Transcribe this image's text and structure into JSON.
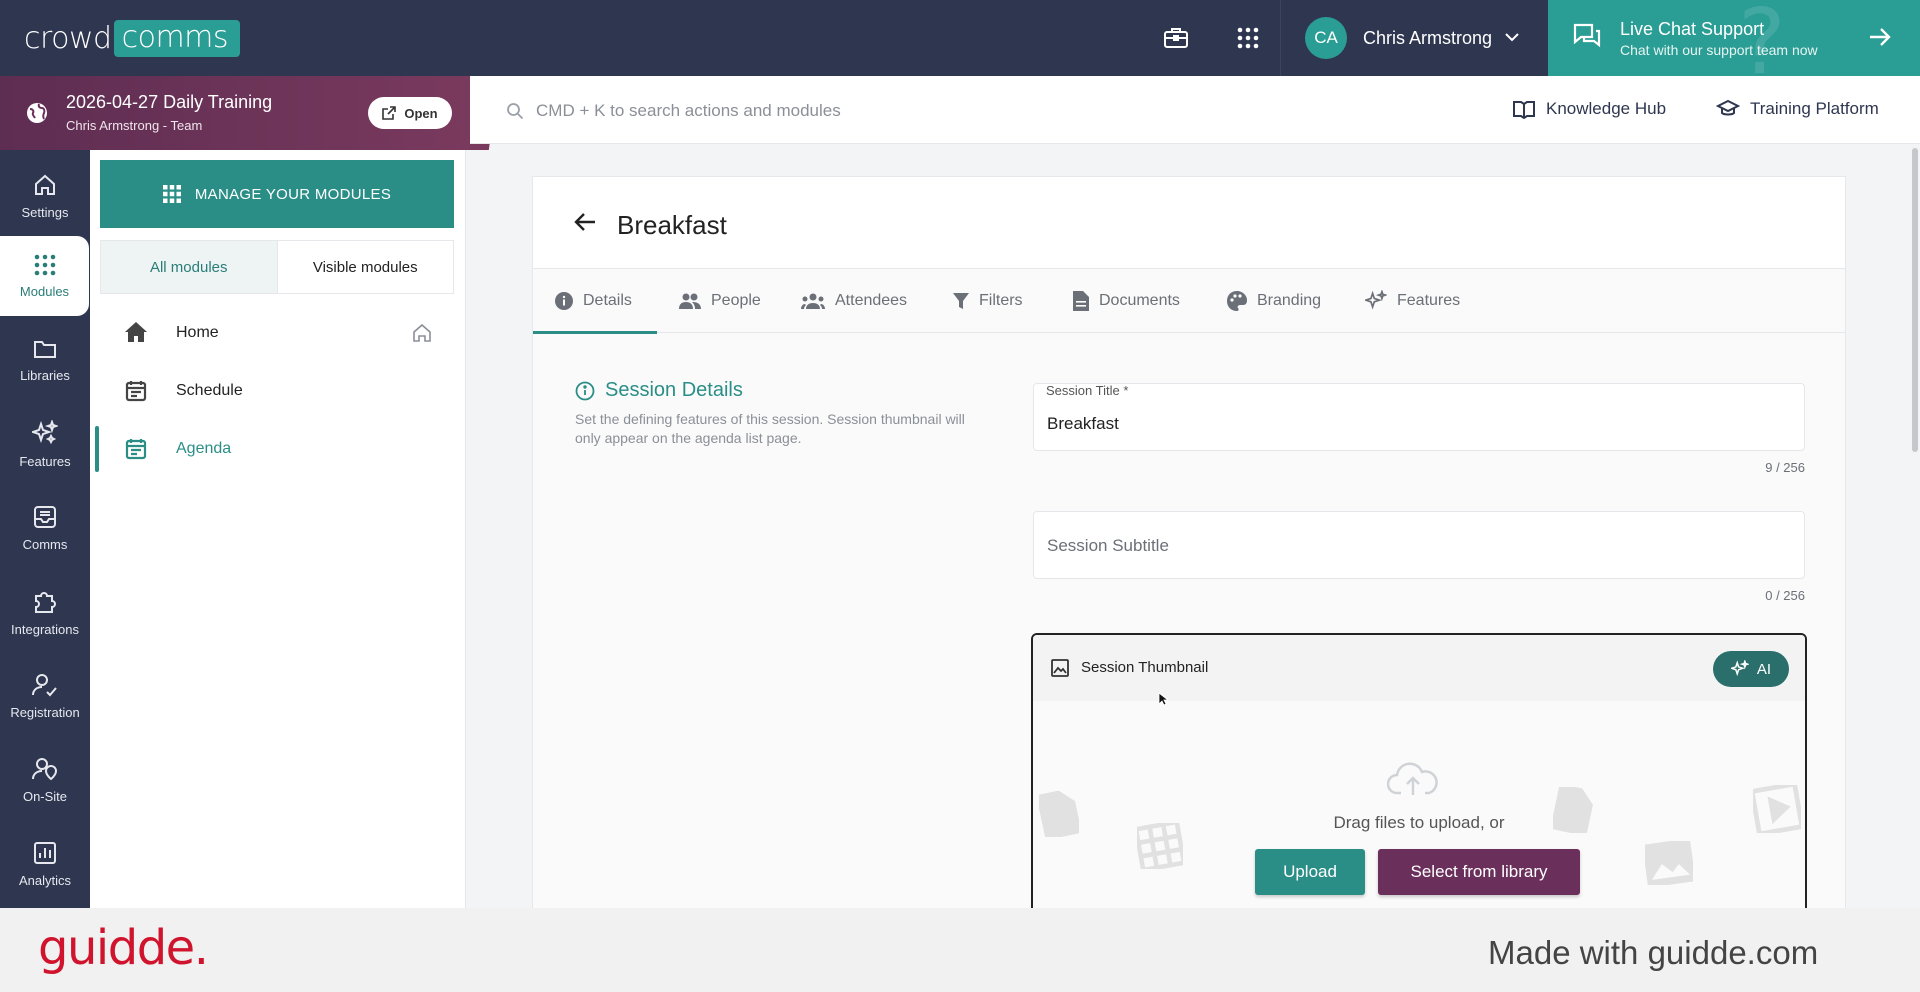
{
  "topbar": {
    "logo_left": "crowd",
    "logo_right": "comms",
    "user_initials": "CA",
    "user_name": "Chris Armstrong",
    "live_chat_title": "Live Chat Support",
    "live_chat_sub": "Chat with our support team now"
  },
  "event": {
    "title": "2026-04-27 Daily Training",
    "subtitle": "Chris Armstrong - Team",
    "open_label": "Open"
  },
  "search": {
    "placeholder": "CMD + K to search actions and modules",
    "knowledge_hub": "Knowledge Hub",
    "training_platform": "Training Platform"
  },
  "iconnav": {
    "items": [
      {
        "label": "Settings",
        "icon": "home-icon"
      },
      {
        "label": "Modules",
        "icon": "grid-icon"
      },
      {
        "label": "Libraries",
        "icon": "folder-icon"
      },
      {
        "label": "Features",
        "icon": "sparkle-icon"
      },
      {
        "label": "Comms",
        "icon": "inbox-icon"
      },
      {
        "label": "Integrations",
        "icon": "puzzle-icon"
      },
      {
        "label": "Registration",
        "icon": "user-check-icon"
      },
      {
        "label": "On-Site",
        "icon": "user-location-icon"
      },
      {
        "label": "Analytics",
        "icon": "chart-icon"
      }
    ],
    "active_index": 1
  },
  "modules": {
    "manage_label": "MANAGE YOUR MODULES",
    "tab_all": "All modules",
    "tab_visible": "Visible modules",
    "items": [
      {
        "label": "Home"
      },
      {
        "label": "Schedule"
      },
      {
        "label": "Agenda"
      }
    ]
  },
  "main": {
    "title": "Breakfast",
    "tabs": [
      {
        "label": "Details"
      },
      {
        "label": "People"
      },
      {
        "label": "Attendees"
      },
      {
        "label": "Filters"
      },
      {
        "label": "Documents"
      },
      {
        "label": "Branding"
      },
      {
        "label": "Features"
      }
    ],
    "section_title": "Session Details",
    "section_desc": "Set the defining features of this session. Session thumbnail will only appear on the agenda list page.",
    "session_title_label": "Session Title *",
    "session_title_value": "Breakfast",
    "session_title_counter": "9 / 256",
    "session_subtitle_placeholder": "Session Subtitle",
    "session_subtitle_counter": "0 / 256",
    "thumbnail_label": "Session Thumbnail",
    "ai_label": "AI",
    "drag_text": "Drag files to upload, or",
    "upload_label": "Upload",
    "library_label": "Select from library"
  },
  "footer": {
    "brand": "guidde.",
    "made_with": "Made with guidde.com"
  },
  "colors": {
    "navy": "#2e3650",
    "teal": "#2a8e87",
    "plum": "#6b2f5b",
    "brand_red": "#d0142d"
  }
}
